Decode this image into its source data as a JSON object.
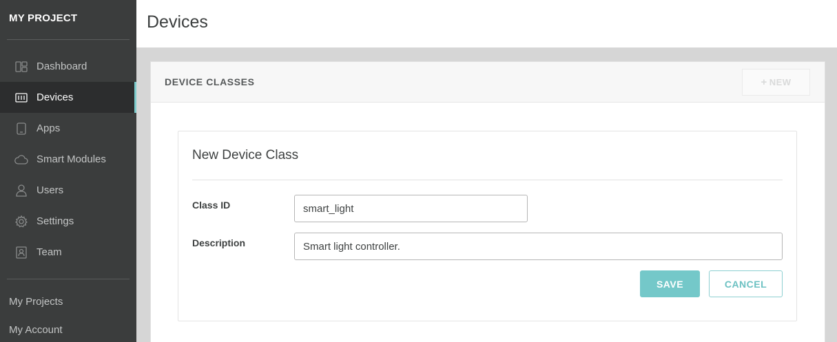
{
  "sidebar": {
    "brand": "MY PROJECT",
    "items": [
      {
        "label": "Dashboard",
        "icon": "dashboard-icon"
      },
      {
        "label": "Devices",
        "icon": "devices-icon",
        "active": true
      },
      {
        "label": "Apps",
        "icon": "phone-icon"
      },
      {
        "label": "Smart Modules",
        "icon": "cloud-icon"
      },
      {
        "label": "Users",
        "icon": "user-icon"
      },
      {
        "label": "Settings",
        "icon": "gear-icon"
      },
      {
        "label": "Team",
        "icon": "team-icon"
      }
    ],
    "bottom_links": [
      "My Projects",
      "My Account"
    ],
    "active_accent": "#7dcccc"
  },
  "header": {
    "title": "Devices"
  },
  "panel": {
    "title": "DEVICE CLASSES",
    "new_button": "NEW",
    "new_icon": "plus-icon"
  },
  "form": {
    "title": "New Device Class",
    "class_id_label": "Class ID",
    "class_id_value": "smart_light",
    "description_label": "Description",
    "description_value": "Smart light controller.",
    "save_label": "SAVE",
    "cancel_label": "CANCEL",
    "accent": "#74c8c9"
  }
}
